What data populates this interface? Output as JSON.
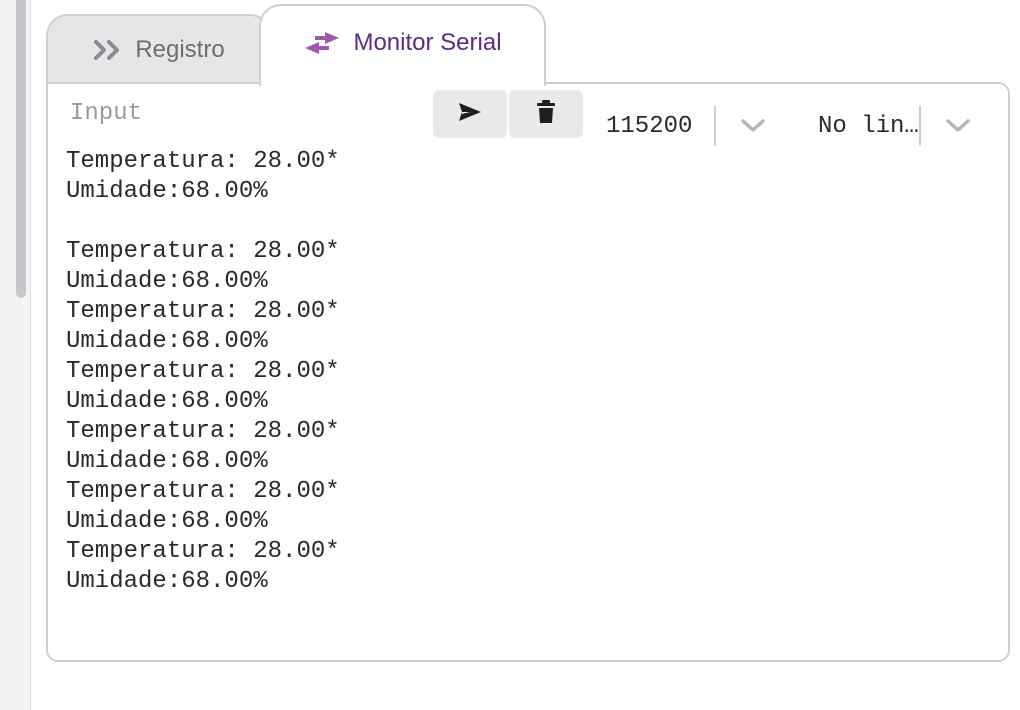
{
  "tabs": [
    {
      "label": "Registro",
      "icon": "double-chevron-right-icon",
      "active": false
    },
    {
      "label": "Monitor Serial",
      "icon": "swap-arrows-icon",
      "active": true
    }
  ],
  "toolbar": {
    "input_placeholder": "Input",
    "input_value": "",
    "send_icon": "send-icon",
    "clear_icon": "trash-icon",
    "baud_rate": "115200",
    "line_ending": "No lin…"
  },
  "output": {
    "lines": [
      "Umidade:68.00%",
      "Temperatura: 28.00*",
      "Umidade:68.00%",
      "",
      "Temperatura: 28.00*",
      "Umidade:68.00%",
      "Temperatura: 28.00*",
      "Umidade:68.00%",
      "Temperatura: 28.00*",
      "Umidade:68.00%",
      "Temperatura: 28.00*",
      "Umidade:68.00%",
      "Temperatura: 28.00*",
      "Umidade:68.00%",
      "Temperatura: 28.00*",
      "Umidade:68.00%"
    ]
  },
  "colors": {
    "accent": "#5d2b82",
    "icon_purple": "#9b5aa8",
    "inactive_text": "#6d6d72"
  }
}
